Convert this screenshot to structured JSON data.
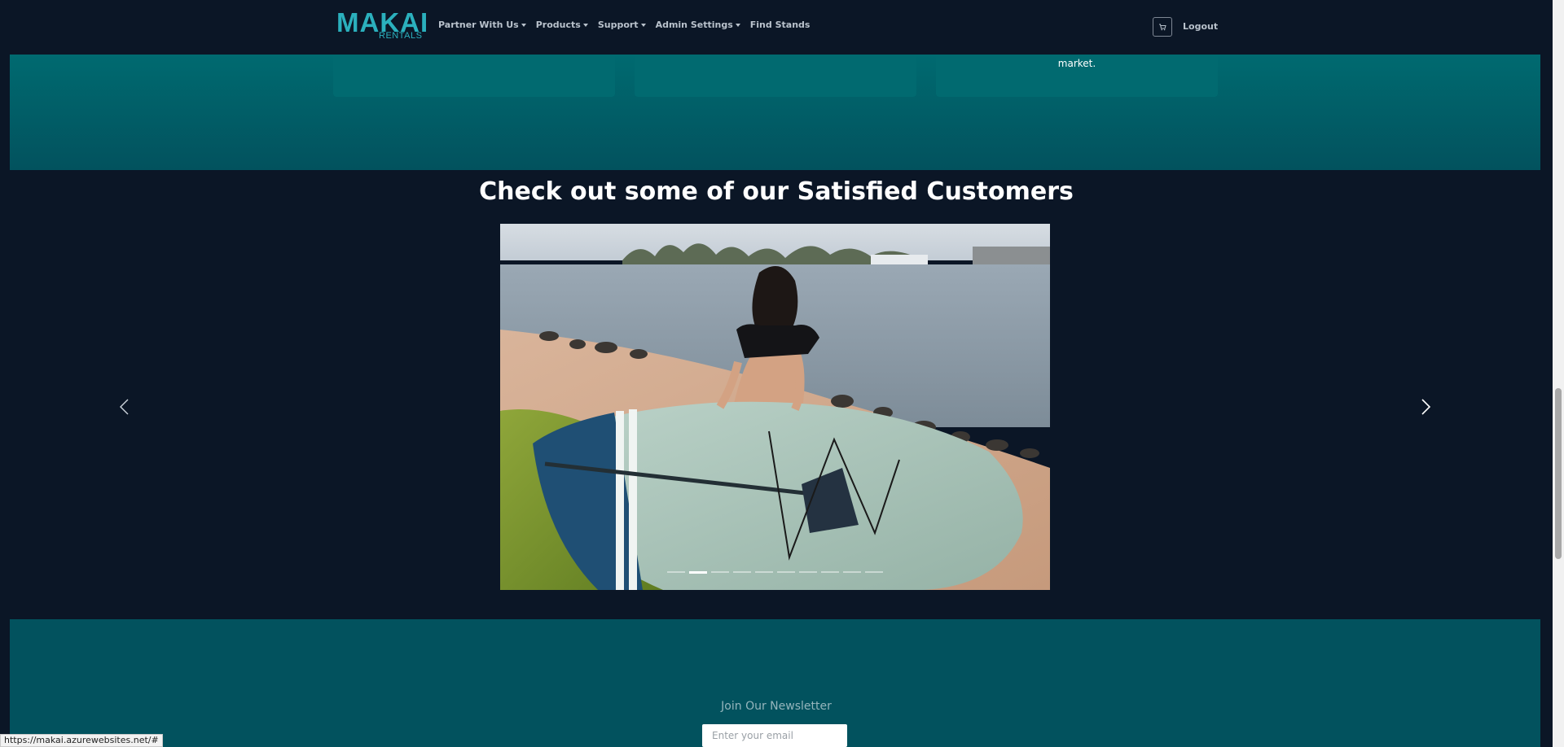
{
  "navbar": {
    "logo_main": "MAKAI",
    "logo_sub": "RENTALS",
    "items": [
      {
        "label": "Partner With Us",
        "dropdown": true
      },
      {
        "label": "Products",
        "dropdown": true
      },
      {
        "label": "Support",
        "dropdown": true
      },
      {
        "label": "Admin Settings",
        "dropdown": true
      },
      {
        "label": "Find Stands",
        "dropdown": false
      }
    ],
    "cart_icon": "cart-icon",
    "logout_label": "Logout"
  },
  "features": {
    "card_3_text": "market."
  },
  "testimonials": {
    "title": "Check out some of our Satisfied Customers",
    "slide_count": 10,
    "active_slide": 1,
    "prev_icon": "chevron-left-icon",
    "next_icon": "chevron-right-icon"
  },
  "newsletter": {
    "title": "Join Our Newsletter",
    "placeholder": "Enter your email"
  },
  "status_bar": {
    "url": "https://makai.azurewebsites.net/#"
  },
  "colors": {
    "background": "#0b1626",
    "teal": "#02525e",
    "brand": "#2bb0bd"
  }
}
